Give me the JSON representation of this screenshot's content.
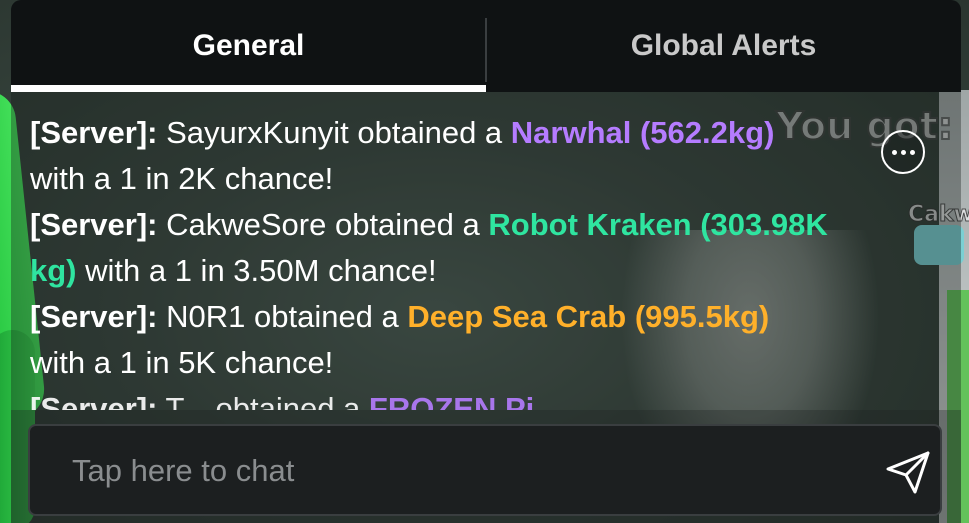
{
  "background": {
    "overlay_text": "You got:",
    "name_tag": "Cakw"
  },
  "tabs": [
    {
      "label": "General",
      "active": true
    },
    {
      "label": "Global Alerts",
      "active": false
    }
  ],
  "messages": [
    {
      "prefix": "[Server]:",
      "text_before": " SayurxKunyit obtained a ",
      "fish": "Narwhal (562.2kg)",
      "text_after": " with a 1 in 2K chance!",
      "fish_color": "#b57cff"
    },
    {
      "prefix": "[Server]:",
      "text_before": " CakweSore obtained a ",
      "fish": "Robot Kraken (303.98K kg)",
      "text_after": " with a 1 in 3.50M chance!",
      "fish_color": "#2fe5a0"
    },
    {
      "prefix": "[Server]:",
      "text_before": " N0R1 obtained a ",
      "fish": "Deep Sea Crab (995.5kg)",
      "text_after": " with a 1 in 5K chance!",
      "fish_color": "#ffb02a"
    },
    {
      "prefix": "[Server]:",
      "text_before": " T... obtained a ",
      "fish": "FROZEN Pi...",
      "text_after": "",
      "fish_color": "#b57cff"
    }
  ],
  "input": {
    "placeholder": "Tap here to chat",
    "value": ""
  },
  "icons": {
    "more": "more-options-icon",
    "send": "send-icon"
  },
  "colors": {
    "tab_bar": "#0f1213",
    "active_tab_underline": "#ffffff",
    "rarity_purple": "#b57cff",
    "rarity_green": "#2fe5a0",
    "rarity_orange": "#ffb02a"
  }
}
